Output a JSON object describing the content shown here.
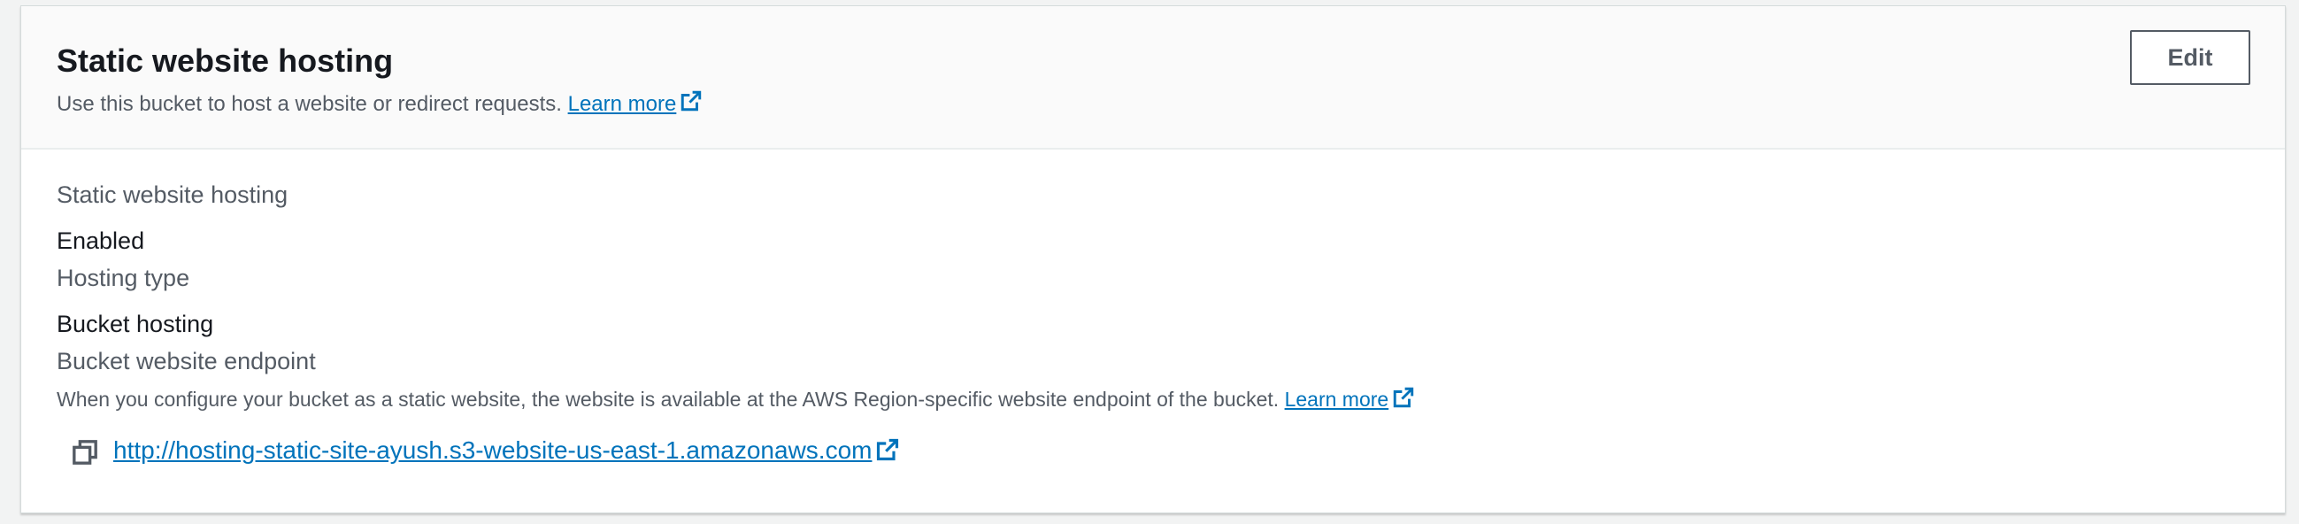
{
  "header": {
    "title": "Static website hosting",
    "description": "Use this bucket to host a website or redirect requests.",
    "learn_more": "Learn more",
    "edit_label": "Edit"
  },
  "details": {
    "hosting_label": "Static website hosting",
    "hosting_value": "Enabled",
    "type_label": "Hosting type",
    "type_value": "Bucket hosting",
    "endpoint_label": "Bucket website endpoint",
    "endpoint_description": "When you configure your bucket as a static website, the website is available at the AWS Region-specific website endpoint of the bucket.",
    "endpoint_learn_more": "Learn more",
    "endpoint_url": "http://hosting-static-site-ayush.s3-website-us-east-1.amazonaws.com"
  },
  "icons": {
    "external": "external-link-icon",
    "copy": "copy-icon"
  },
  "colors": {
    "link": "#0073bb",
    "text": "#16191f",
    "secondary_text": "#545b64",
    "header_bg": "#fafafa",
    "border": "#d5dbdb"
  }
}
